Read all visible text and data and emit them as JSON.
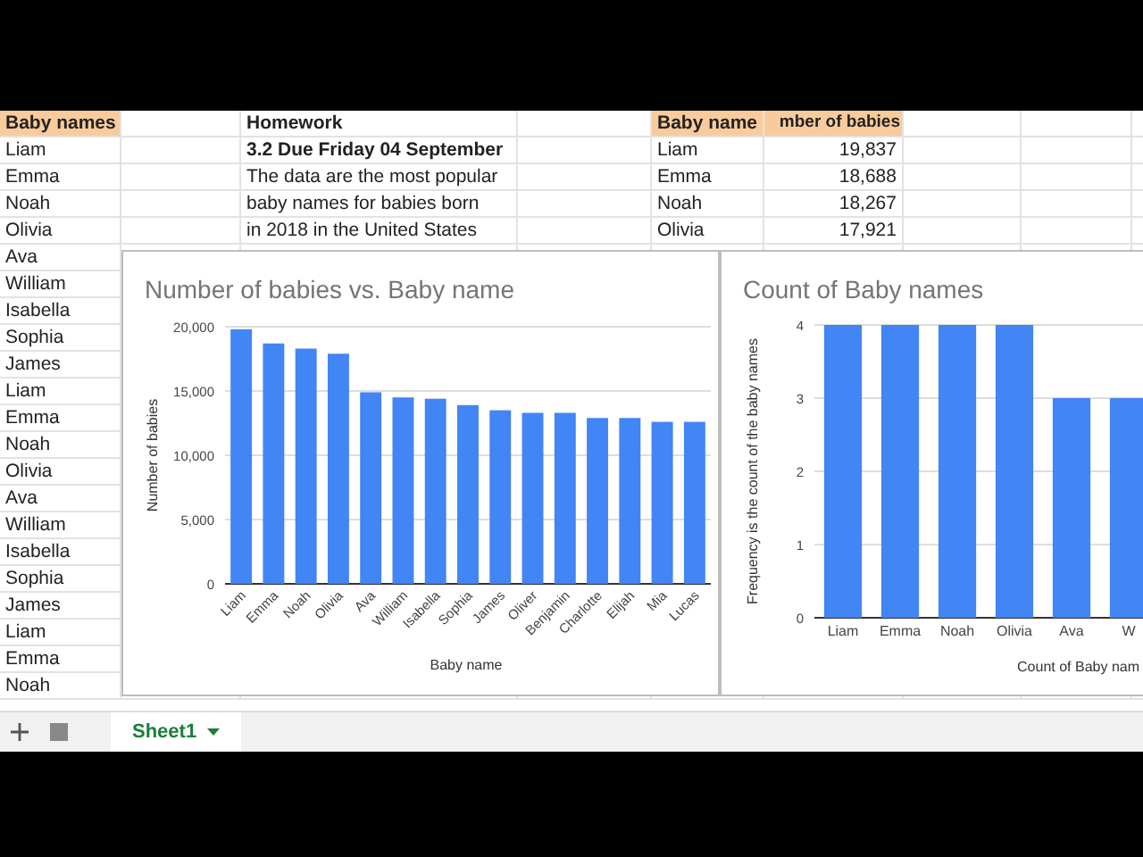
{
  "sheet": {
    "rows": [
      {
        "cells": [
          {
            "text": "Baby names",
            "kind": "header"
          },
          null,
          {
            "text": "Homework",
            "kind": "bold"
          },
          null,
          {
            "text": "Baby name",
            "kind": "header"
          },
          {
            "text": "mber of babies",
            "kind": "header_right"
          }
        ]
      },
      {
        "cells": [
          {
            "text": "Liam",
            "kind": "plain"
          },
          null,
          {
            "text": "3.2  Due Friday 04 September",
            "kind": "bold"
          },
          null,
          {
            "text": "Liam",
            "kind": "plain"
          },
          {
            "text": "19,837",
            "kind": "number"
          }
        ]
      },
      {
        "cells": [
          {
            "text": "Emma",
            "kind": "plain"
          },
          null,
          {
            "text": "The data are the most popular",
            "kind": "plain"
          },
          null,
          {
            "text": "Emma",
            "kind": "plain"
          },
          {
            "text": "18,688",
            "kind": "number"
          }
        ]
      },
      {
        "cells": [
          {
            "text": "Noah",
            "kind": "plain"
          },
          null,
          {
            "text": "baby names for babies born",
            "kind": "plain"
          },
          null,
          {
            "text": "Noah",
            "kind": "plain"
          },
          {
            "text": "18,267",
            "kind": "number"
          }
        ]
      },
      {
        "cells": [
          {
            "text": "Olivia",
            "kind": "plain"
          },
          null,
          {
            "text": "in 2018 in the United States",
            "kind": "plain"
          },
          null,
          {
            "text": "Olivia",
            "kind": "plain"
          },
          {
            "text": "17,921",
            "kind": "number"
          }
        ]
      },
      {
        "cells": [
          {
            "text": "Ava",
            "kind": "plain"
          }
        ]
      },
      {
        "cells": [
          {
            "text": "William",
            "kind": "plain"
          }
        ]
      },
      {
        "cells": [
          {
            "text": "Isabella",
            "kind": "plain"
          }
        ]
      },
      {
        "cells": [
          {
            "text": "Sophia",
            "kind": "plain"
          }
        ]
      },
      {
        "cells": [
          {
            "text": "James",
            "kind": "plain"
          }
        ]
      },
      {
        "cells": [
          {
            "text": "Liam",
            "kind": "plain"
          }
        ]
      },
      {
        "cells": [
          {
            "text": "Emma",
            "kind": "plain"
          }
        ]
      },
      {
        "cells": [
          {
            "text": "Noah",
            "kind": "plain"
          }
        ]
      },
      {
        "cells": [
          {
            "text": "Olivia",
            "kind": "plain"
          }
        ]
      },
      {
        "cells": [
          {
            "text": "Ava",
            "kind": "plain"
          }
        ]
      },
      {
        "cells": [
          {
            "text": "William",
            "kind": "plain"
          }
        ]
      },
      {
        "cells": [
          {
            "text": "Isabella",
            "kind": "plain"
          }
        ]
      },
      {
        "cells": [
          {
            "text": "Sophia",
            "kind": "plain"
          }
        ]
      },
      {
        "cells": [
          {
            "text": "James",
            "kind": "plain"
          }
        ]
      },
      {
        "cells": [
          {
            "text": "Liam",
            "kind": "plain"
          }
        ]
      },
      {
        "cells": [
          {
            "text": "Emma",
            "kind": "plain"
          }
        ]
      },
      {
        "cells": [
          {
            "text": "Noah",
            "kind": "plain"
          }
        ]
      }
    ]
  },
  "charts": [
    {
      "chart_data": {
        "type": "bar",
        "title": "Number of babies vs. Baby name",
        "xlabel": "Baby name",
        "ylabel": "Number of babies",
        "categories": [
          "Liam",
          "Emma",
          "Noah",
          "Olivia",
          "Ava",
          "William",
          "Isabella",
          "Sophia",
          "James",
          "Oliver",
          "Benjamin",
          "Charlotte",
          "Elijah",
          "Mia",
          "Lucas"
        ],
        "series": [
          {
            "color": "#4285f4",
            "values": [
              19800,
              18700,
              18300,
              17900,
              14900,
              14500,
              14400,
              13900,
              13500,
              13300,
              13300,
              12900,
              12900,
              12600,
              12600
            ]
          }
        ],
        "ylim": [
          0,
          20000
        ],
        "grid": true,
        "yticks": [
          {
            "value": 0,
            "label": "0"
          },
          {
            "value": 5000,
            "label": "5,000"
          },
          {
            "value": 10000,
            "label": "10,000"
          },
          {
            "value": 15000,
            "label": "15,000"
          },
          {
            "value": 20000,
            "label": "20,000"
          }
        ]
      }
    },
    {
      "chart_data": {
        "type": "bar",
        "title": "Count of Baby names",
        "xlabel": "Count of Baby nam",
        "ylabel": "Frequency is the count of the baby names",
        "categories": [
          "Liam",
          "Emma",
          "Noah",
          "Olivia",
          "Ava",
          "W"
        ],
        "series": [
          {
            "color": "#4285f4",
            "values": [
              4,
              4,
              4,
              4,
              3,
              3
            ]
          }
        ],
        "ylim": [
          0,
          4
        ],
        "grid": true,
        "yticks": [
          {
            "value": 0,
            "label": "0"
          },
          {
            "value": 1,
            "label": "1"
          },
          {
            "value": 2,
            "label": "2"
          },
          {
            "value": 3,
            "label": "3"
          },
          {
            "value": 4,
            "label": "4"
          }
        ]
      }
    }
  ],
  "sheet_tabs": [
    {
      "label": "Sheet1",
      "selected": true
    }
  ]
}
